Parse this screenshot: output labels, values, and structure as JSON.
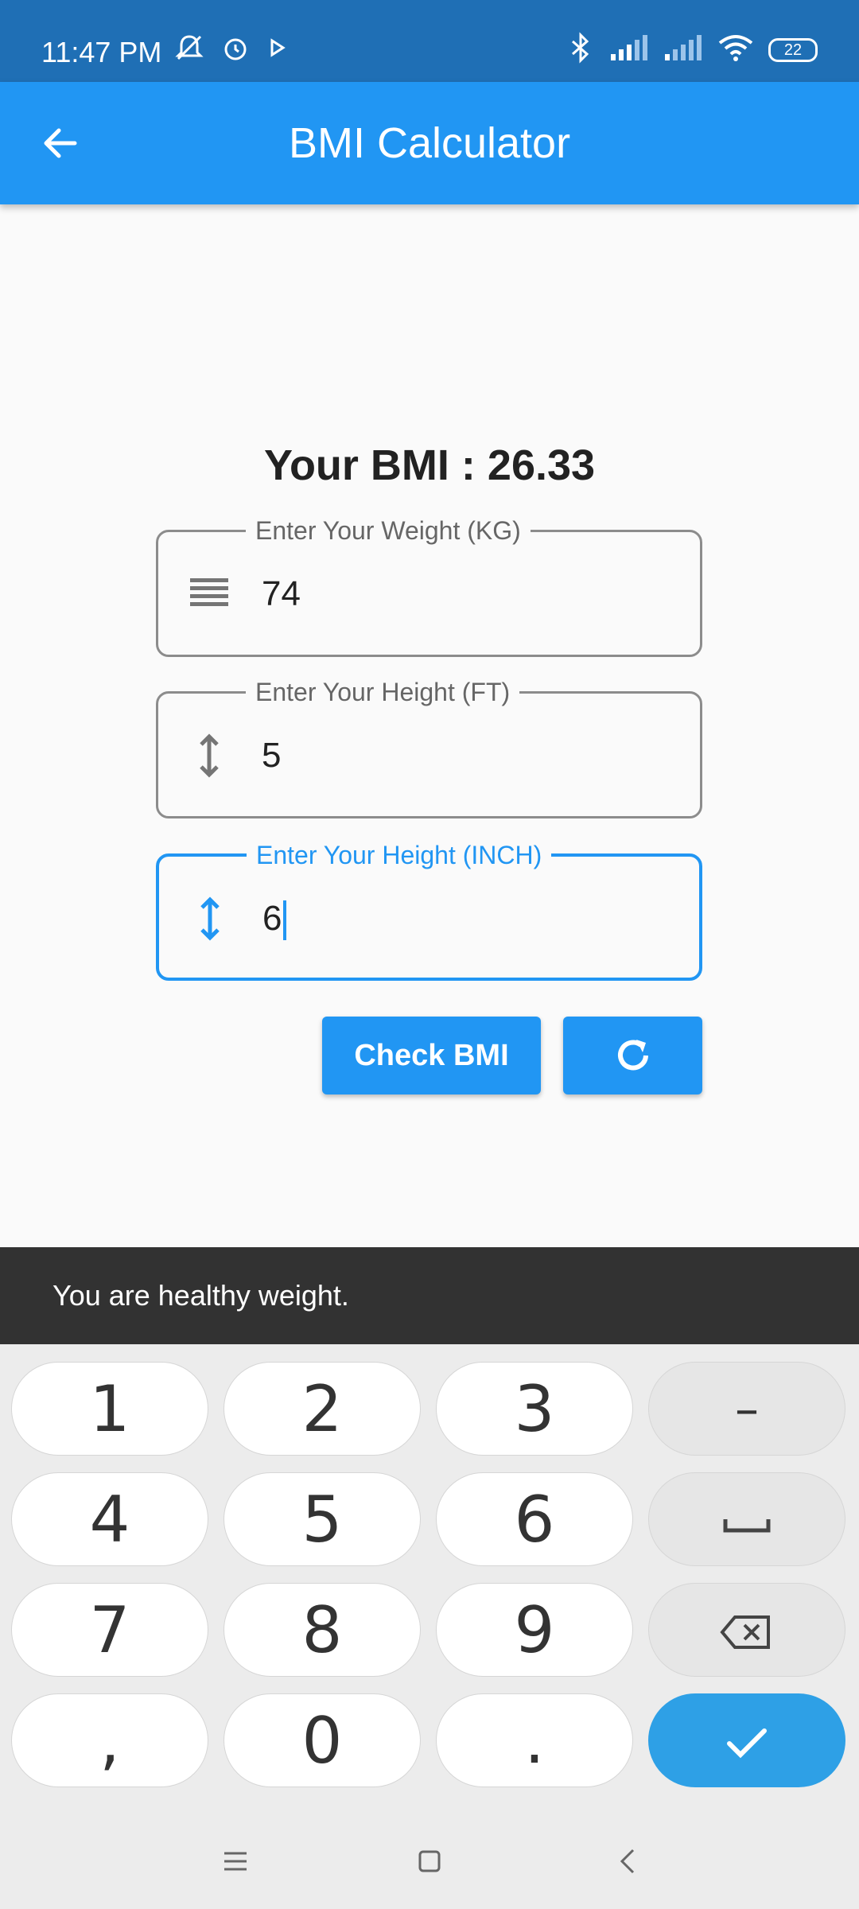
{
  "status_bar": {
    "time": "11:47 PM",
    "battery": "22",
    "icons": [
      "mute-icon",
      "alarm-icon",
      "play-icon",
      "bluetooth-icon",
      "signal-icon",
      "signal-icon",
      "wifi-icon",
      "battery-icon"
    ]
  },
  "app_bar": {
    "title": "BMI Calculator",
    "back_icon": "arrow-back-icon"
  },
  "result": {
    "text": "Your BMI : 26.33"
  },
  "fields": {
    "weight": {
      "label": "Enter Your Weight (KG)",
      "value": "74",
      "icon": "weight-lines-icon"
    },
    "height_ft": {
      "label": "Enter Your Height (FT)",
      "value": "5",
      "icon": "vertical-arrows-icon"
    },
    "height_inch": {
      "label": "Enter Your Height (INCH)",
      "value": "6",
      "icon": "vertical-arrows-icon",
      "focused": true
    }
  },
  "buttons": {
    "check": "Check BMI",
    "reset_icon": "refresh-icon"
  },
  "snackbar": {
    "message": "You are healthy weight."
  },
  "keyboard": {
    "keys": [
      "1",
      "2",
      "3",
      "–",
      "4",
      "5",
      "6",
      "␣",
      "7",
      "8",
      "9",
      "⌫",
      ",",
      "0",
      ".",
      "✓"
    ]
  },
  "colors": {
    "primary": "#2196f3",
    "status_bar": "#1f6fb5",
    "snackbar": "#323232",
    "done_key": "#2ea0e6"
  }
}
